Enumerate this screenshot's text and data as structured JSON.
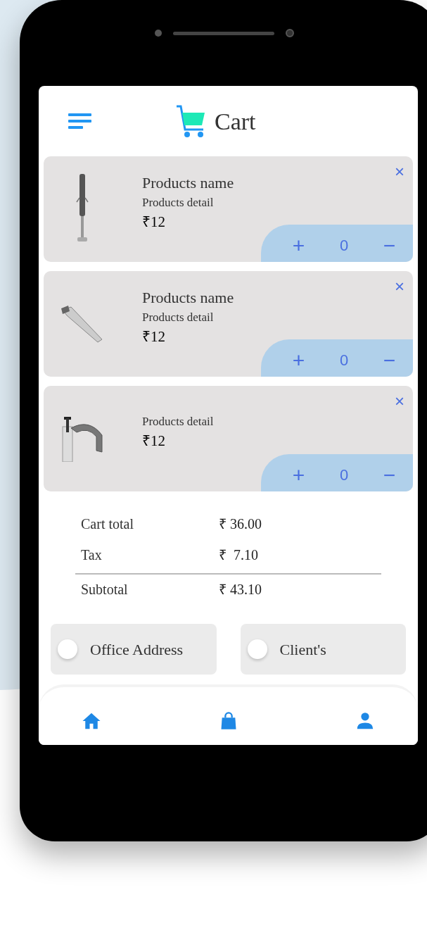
{
  "header": {
    "title": "Cart"
  },
  "products": [
    {
      "kind": "plug",
      "name": "Products name",
      "detail": "Products detail",
      "price": "₹12",
      "plus": "+",
      "quantity": "0",
      "minus": "−",
      "remove": "×"
    },
    {
      "kind": "anchor",
      "name": "Products name",
      "detail": "Products detail",
      "price": "₹12",
      "plus": "+",
      "quantity": "0",
      "minus": "−",
      "remove": "×"
    },
    {
      "kind": "clip",
      "detail": "Products detail",
      "price": "₹12",
      "plus": "+",
      "quantity": "0",
      "minus": "−",
      "remove": "×"
    }
  ],
  "summary": [
    {
      "label": "Cart total",
      "value": "₹ 36.00"
    },
    {
      "label": "Tax",
      "value": "₹  7.10"
    },
    {
      "label": "Subtotal",
      "value": "₹ 43.10"
    }
  ],
  "addresses": [
    {
      "label": "Office Address",
      "selected": false
    },
    {
      "label": "Client's",
      "selected": false
    }
  ],
  "nav": [
    {
      "kind": "home"
    },
    {
      "kind": "bag"
    },
    {
      "kind": "person"
    }
  ]
}
